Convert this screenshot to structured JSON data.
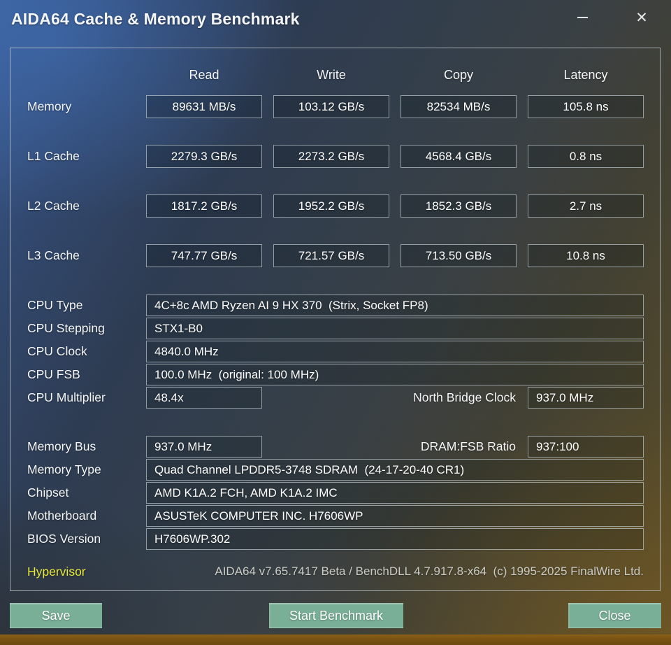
{
  "window": {
    "title": "AIDA64 Cache & Memory Benchmark",
    "minimize_icon": "minimize-dash",
    "close_icon": "✕"
  },
  "bench": {
    "columns": [
      "Read",
      "Write",
      "Copy",
      "Latency"
    ],
    "rows": [
      {
        "label": "Memory",
        "read": "89631 MB/s",
        "write": "103.12 GB/s",
        "copy": "82534 MB/s",
        "latency": "105.8 ns"
      },
      {
        "label": "L1 Cache",
        "read": "2279.3 GB/s",
        "write": "2273.2 GB/s",
        "copy": "4568.4 GB/s",
        "latency": "0.8 ns"
      },
      {
        "label": "L2 Cache",
        "read": "1817.2 GB/s",
        "write": "1952.2 GB/s",
        "copy": "1852.3 GB/s",
        "latency": "2.7 ns"
      },
      {
        "label": "L3 Cache",
        "read": "747.77 GB/s",
        "write": "721.57 GB/s",
        "copy": "713.50 GB/s",
        "latency": "10.8 ns"
      }
    ]
  },
  "cpu": {
    "type_label": "CPU Type",
    "type_value": "4C+8c AMD Ryzen AI 9 HX 370  (Strix, Socket FP8)",
    "stepping_label": "CPU Stepping",
    "stepping_value": "STX1-B0",
    "clock_label": "CPU Clock",
    "clock_value": "4840.0 MHz",
    "fsb_label": "CPU FSB",
    "fsb_value": "100.0 MHz  (original: 100 MHz)",
    "multiplier_label": "CPU Multiplier",
    "multiplier_value": "48.4x",
    "north_bridge_label": "North Bridge Clock",
    "north_bridge_value": "937.0 MHz"
  },
  "memory": {
    "bus_label": "Memory Bus",
    "bus_value": "937.0 MHz",
    "dram_fsb_label": "DRAM:FSB Ratio",
    "dram_fsb_value": "937:100",
    "type_label": "Memory Type",
    "type_value": "Quad Channel LPDDR5-3748 SDRAM  (24-17-20-40 CR1)",
    "chipset_label": "Chipset",
    "chipset_value": "AMD K1A.2 FCH, AMD K1A.2 IMC",
    "motherboard_label": "Motherboard",
    "motherboard_value": "ASUSTeK COMPUTER INC. H7606WP",
    "bios_label": "BIOS Version",
    "bios_value": "H7606WP.302"
  },
  "footer": {
    "hypervisor_label": "Hypervisor",
    "version_text": "AIDA64 v7.65.7417 Beta / BenchDLL 4.7.917.8-x64  (c) 1995-2025 FinalWire Ltd."
  },
  "buttons": {
    "save": "Save",
    "start_benchmark": "Start Benchmark",
    "close": "Close"
  },
  "colors": {
    "button_teal": "#79af97",
    "hypervisor_yellow": "#e9eb3c",
    "bottom_bar_orange": "#7a5414",
    "background_blue": "#3a5c94",
    "background_olive": "#584b27"
  }
}
